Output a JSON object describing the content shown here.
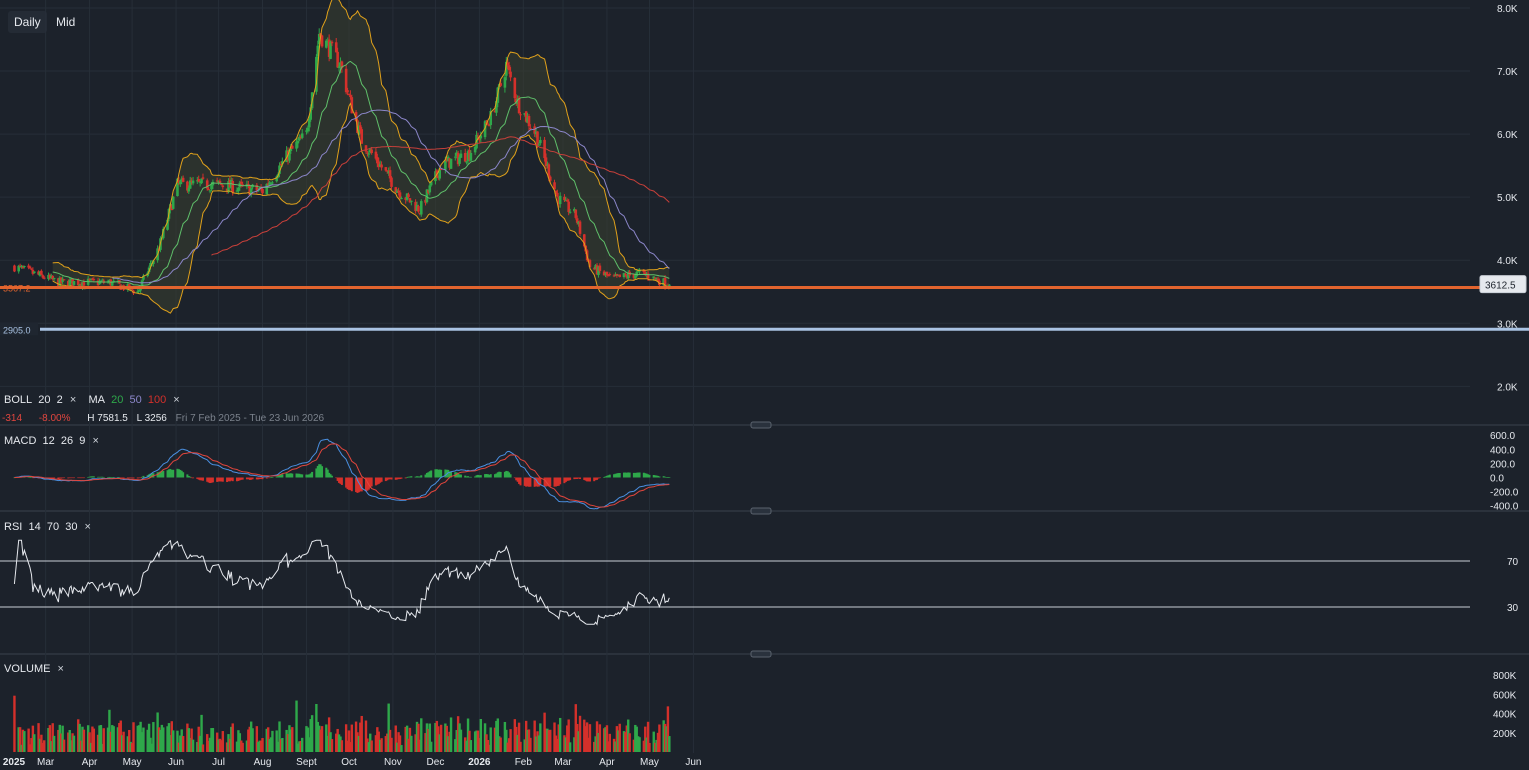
{
  "toolbar": {
    "interval": "Daily",
    "mode": "Mid"
  },
  "price_axis": {
    "ticks": [
      "8.0K",
      "7.0K",
      "6.0K",
      "5.0K",
      "4.0K",
      "3.0K",
      "2.0K"
    ]
  },
  "macd_axis": {
    "ticks": [
      "600.0",
      "400.0",
      "200.0",
      "0.0",
      "-200.0",
      "-400.0"
    ]
  },
  "rsi_axis": {
    "ticks": [
      "70",
      "30"
    ]
  },
  "volume_axis": {
    "ticks": [
      "800K",
      "600K",
      "400K",
      "200K"
    ]
  },
  "time_axis": {
    "labels": [
      "2025",
      "Mar",
      "Apr",
      "May",
      "Jun",
      "Jul",
      "Aug",
      "Sept",
      "Oct",
      "Nov",
      "Dec",
      "2026",
      "Feb",
      "Mar",
      "Apr",
      "May",
      "Jun"
    ]
  },
  "price_labels": {
    "last": "3612.5",
    "support1": "3567.2",
    "support2": "2905.0"
  },
  "legend": {
    "boll": {
      "name": "BOLL",
      "period": "20",
      "dev": "2"
    },
    "ma": {
      "name": "MA",
      "p1": "20",
      "p2": "50",
      "p3": "100"
    },
    "change_abs": "-314",
    "change_pct": "-8.00%",
    "high": "H 7581.5",
    "low": "L 3256",
    "range": "Fri 7 Feb 2025 - Tue 23 Jun 2026",
    "macd": {
      "name": "MACD",
      "fast": "12",
      "slow": "26",
      "signal": "9"
    },
    "rsi": {
      "name": "RSI",
      "period": "14",
      "upper": "70",
      "lower": "30"
    },
    "volume": {
      "name": "VOLUME"
    },
    "close": "×"
  },
  "colors": {
    "up": "#2ea84a",
    "down": "#d4302b",
    "boll": "#e0a11b",
    "ma20": "#5fbf6a",
    "ma50": "#8b86c9",
    "ma100": "#c8403a",
    "support1": "#e2642e",
    "support2": "#a9c3e3",
    "macd": "#4a8fe0",
    "signal": "#e0453c",
    "rsi": "#e6e9ee",
    "bg": "#1c222b"
  },
  "chart_data": {
    "type": "candlestick",
    "y_range": [
      1800,
      8000
    ],
    "key_points": [
      {
        "date": "2025-02-07",
        "close": 3900
      },
      {
        "date": "2025-03-10",
        "close": 3650
      },
      {
        "date": "2025-04-15",
        "close": 3650
      },
      {
        "date": "2025-05-05",
        "close": 3500
      },
      {
        "date": "2025-05-20",
        "close": 4200
      },
      {
        "date": "2025-06-02",
        "close": 5200
      },
      {
        "date": "2025-07-01",
        "close": 5200
      },
      {
        "date": "2025-08-01",
        "close": 5100
      },
      {
        "date": "2025-08-20",
        "close": 5700
      },
      {
        "date": "2025-09-01",
        "close": 6000
      },
      {
        "date": "2025-09-10",
        "close": 7600
      },
      {
        "date": "2025-09-25",
        "close": 7100
      },
      {
        "date": "2025-10-02",
        "close": 6500
      },
      {
        "date": "2025-10-10",
        "close": 5900
      },
      {
        "date": "2025-10-20",
        "close": 5600
      },
      {
        "date": "2025-11-05",
        "close": 5100
      },
      {
        "date": "2025-11-20",
        "close": 4800
      },
      {
        "date": "2025-12-05",
        "close": 5500
      },
      {
        "date": "2025-12-25",
        "close": 5700
      },
      {
        "date": "2026-01-10",
        "close": 6300
      },
      {
        "date": "2026-01-20",
        "close": 7100
      },
      {
        "date": "2026-01-28",
        "close": 6500
      },
      {
        "date": "2026-02-10",
        "close": 6000
      },
      {
        "date": "2026-02-25",
        "close": 5000
      },
      {
        "date": "2026-03-10",
        "close": 4700
      },
      {
        "date": "2026-03-20",
        "close": 3900
      },
      {
        "date": "2026-04-05",
        "close": 3700
      },
      {
        "date": "2026-04-25",
        "close": 3800
      },
      {
        "date": "2026-05-15",
        "close": 3612.5
      }
    ],
    "last_close": 3612.5,
    "high": 7581.5,
    "low": 3256,
    "ma_periods": [
      20,
      50,
      100
    ],
    "bollinger": {
      "period": 20,
      "dev": 2
    },
    "macd": {
      "fast": 12,
      "slow": 26,
      "signal": 9,
      "range": [
        -400,
        600
      ]
    },
    "rsi": {
      "period": 14,
      "levels": [
        70,
        30
      ]
    },
    "volume_range": [
      0,
      900000
    ],
    "volume_max_bar": 880000
  }
}
